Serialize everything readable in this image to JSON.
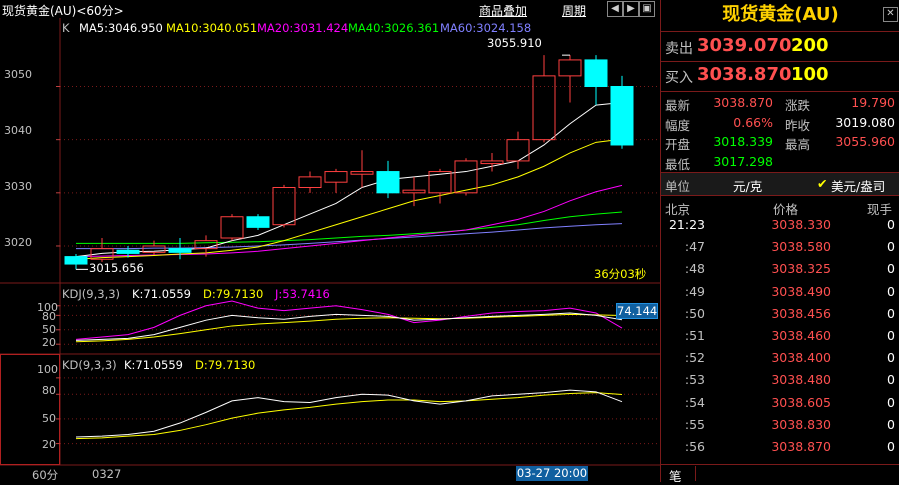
{
  "toolbar": {
    "title": "现货黄金(AU)<60分>",
    "overlay_link": "商品叠加",
    "period_link": "周期"
  },
  "main_chart": {
    "k_label": "K",
    "ma5": "MA5:3046.950",
    "ma10": "MA10:3040.051",
    "ma20": "MA20:3031.424",
    "ma40": "MA40:3026.361",
    "ma60": "MA60:3024.158",
    "high_marker": "3055.910",
    "low_marker": "3015.656",
    "countdown": "36分03秒",
    "y_ticks": [
      "3050",
      "3040",
      "3030",
      "3020"
    ],
    "y_values": [
      3050,
      3040,
      3030,
      3020
    ],
    "ylim": [
      3013.6,
      3059.5
    ],
    "colors": {
      "ma5": "#ffffff",
      "ma10": "#ffff00",
      "ma20": "#ff00ff",
      "ma40": "#00ff00",
      "ma60": "#8080ff",
      "up": "#ff4040",
      "down": "#00ffff"
    },
    "candles": [
      {
        "o": 3018.0,
        "h": 3018.5,
        "l": 3015.6,
        "c": 3016.6
      },
      {
        "o": 3017.5,
        "h": 3021.5,
        "l": 3017.0,
        "c": 3019.5
      },
      {
        "o": 3019.2,
        "h": 3020.0,
        "l": 3017.8,
        "c": 3018.6
      },
      {
        "o": 3018.8,
        "h": 3021.0,
        "l": 3018.3,
        "c": 3020.0
      },
      {
        "o": 3019.5,
        "h": 3021.5,
        "l": 3017.5,
        "c": 3018.8
      },
      {
        "o": 3019.5,
        "h": 3022.0,
        "l": 3018.0,
        "c": 3021.0
      },
      {
        "o": 3021.5,
        "h": 3026.0,
        "l": 3021.0,
        "c": 3025.5
      },
      {
        "o": 3025.5,
        "h": 3026.0,
        "l": 3023.0,
        "c": 3023.5
      },
      {
        "o": 3024.0,
        "h": 3031.5,
        "l": 3023.5,
        "c": 3031.0
      },
      {
        "o": 3031.0,
        "h": 3034.0,
        "l": 3030.0,
        "c": 3033.0
      },
      {
        "o": 3032.0,
        "h": 3034.5,
        "l": 3030.0,
        "c": 3034.0
      },
      {
        "o": 3033.5,
        "h": 3038.0,
        "l": 3031.0,
        "c": 3034.0
      },
      {
        "o": 3034.0,
        "h": 3036.0,
        "l": 3029.0,
        "c": 3030.0
      },
      {
        "o": 3030.0,
        "h": 3033.0,
        "l": 3027.5,
        "c": 3030.5
      },
      {
        "o": 3030.0,
        "h": 3034.5,
        "l": 3028.0,
        "c": 3034.0
      },
      {
        "o": 3030.0,
        "h": 3036.5,
        "l": 3029.5,
        "c": 3036.0
      },
      {
        "o": 3035.5,
        "h": 3037.5,
        "l": 3034.0,
        "c": 3036.0
      },
      {
        "o": 3036.0,
        "h": 3041.5,
        "l": 3034.5,
        "c": 3040.0
      },
      {
        "o": 3040.0,
        "h": 3055.9,
        "l": 3039.5,
        "c": 3052.0
      },
      {
        "o": 3052.0,
        "h": 3055.9,
        "l": 3047.0,
        "c": 3055.0
      },
      {
        "o": 3055.0,
        "h": 3055.9,
        "l": 3046.5,
        "c": 3050.0
      },
      {
        "o": 3050.0,
        "h": 3052.0,
        "l": 3038.3,
        "c": 3039.0
      }
    ],
    "ma5_vals": [
      3018.0,
      3018.6,
      3018.9,
      3019.0,
      3019.3,
      3019.6,
      3021.0,
      3022.0,
      3024.0,
      3026.0,
      3028.0,
      3031.0,
      3032.5,
      3033.0,
      3033.5,
      3034.0,
      3035.0,
      3036.0,
      3039.0,
      3043.0,
      3046.5,
      3047.0
    ],
    "ma10_vals": [
      3017.5,
      3017.8,
      3018.0,
      3018.2,
      3018.5,
      3018.7,
      3019.2,
      3019.8,
      3021.0,
      3022.5,
      3024.0,
      3025.5,
      3027.0,
      3028.5,
      3029.5,
      3030.5,
      3031.5,
      3033.0,
      3035.0,
      3037.5,
      3039.5,
      3040.1
    ],
    "ma20_vals": [
      3018.0,
      3018.1,
      3018.2,
      3018.3,
      3018.4,
      3018.5,
      3018.7,
      3019.0,
      3019.5,
      3020.0,
      3020.5,
      3021.0,
      3021.5,
      3022.0,
      3022.5,
      3023.0,
      3024.0,
      3025.0,
      3026.5,
      3028.5,
      3030.2,
      3031.4
    ],
    "ma40_vals": [
      3020.5,
      3020.5,
      3020.5,
      3020.5,
      3020.5,
      3020.6,
      3020.7,
      3020.8,
      3021.0,
      3021.2,
      3021.5,
      3021.8,
      3022.0,
      3022.3,
      3022.6,
      3023.0,
      3023.5,
      3024.0,
      3024.8,
      3025.5,
      3026.0,
      3026.4
    ],
    "ma60_vals": [
      3019.5,
      3019.5,
      3019.5,
      3019.6,
      3019.6,
      3019.7,
      3019.8,
      3020.0,
      3020.2,
      3020.5,
      3020.8,
      3021.1,
      3021.4,
      3021.7,
      3022.0,
      3022.3,
      3022.6,
      3023.0,
      3023.4,
      3023.7,
      3024.0,
      3024.2
    ]
  },
  "kdj_panel": {
    "label": "KDJ(9,3,3)",
    "k": "K:71.0559",
    "d": "D:79.7130",
    "j": "J:53.7416",
    "current_badge": "74.144",
    "y_ticks": [
      "100",
      "80",
      "50",
      "20"
    ],
    "y_values": [
      100,
      80,
      50,
      20
    ],
    "ylim": [
      10,
      112
    ],
    "k_vals": [
      28,
      30,
      32,
      40,
      55,
      70,
      80,
      75,
      72,
      78,
      82,
      80,
      78,
      70,
      72,
      75,
      78,
      80,
      82,
      85,
      80,
      71
    ],
    "d_vals": [
      25,
      27,
      30,
      35,
      42,
      50,
      58,
      62,
      65,
      68,
      72,
      74,
      75,
      74,
      73,
      74,
      76,
      78,
      80,
      82,
      81,
      79.7
    ],
    "j_vals": [
      30,
      35,
      40,
      55,
      80,
      100,
      110,
      95,
      90,
      95,
      100,
      92,
      82,
      65,
      70,
      78,
      85,
      88,
      90,
      95,
      85,
      53.7
    ]
  },
  "kd_panel": {
    "label": "KD(9,3,3)",
    "k": "K:71.0559",
    "d": "D:79.7130",
    "y_ticks": [
      "100",
      "80",
      "50",
      "20"
    ],
    "y_values": [
      100,
      80,
      50,
      20
    ],
    "ylim": [
      0,
      112
    ],
    "k_vals": [
      28,
      29,
      31,
      35,
      45,
      58,
      72,
      76,
      71,
      70,
      76,
      80,
      79,
      72,
      68,
      72,
      78,
      80,
      82,
      85,
      83,
      71
    ],
    "d_vals": [
      26,
      27,
      29,
      31,
      36,
      43,
      51,
      57,
      61,
      64,
      68,
      71,
      73,
      73,
      71,
      72,
      74,
      76,
      79,
      81,
      82,
      79.7
    ]
  },
  "bottom_axis": {
    "period": "60分",
    "date_start": "0327",
    "cursor_time": "03-27 20:00"
  },
  "quote_panel": {
    "title": "现货黄金(AU)",
    "sell_label": "卖出",
    "sell_price": "3039.070",
    "sell_vol": "200",
    "buy_label": "买入",
    "buy_price": "3038.870",
    "buy_vol": "100",
    "stats": [
      {
        "l1": "最新",
        "v1": "3038.870",
        "c1": "#ff5050",
        "l2": "涨跌",
        "v2": "19.790",
        "c2": "#ff5050"
      },
      {
        "l1": "幅度",
        "v1": "0.66%",
        "c1": "#ff5050",
        "l2": "昨收",
        "v2": "3019.080",
        "c2": "#ffffff"
      },
      {
        "l1": "开盘",
        "v1": "3018.339",
        "c1": "#00ff00",
        "l2": "最高",
        "v2": "3055.960",
        "c2": "#ff5050"
      },
      {
        "l1": "最低",
        "v1": "3017.298",
        "c1": "#00ff00",
        "l2": "",
        "v2": "",
        "c2": "#ffffff"
      }
    ],
    "unit_label": "单位",
    "unit_value": "元/克",
    "unit_option": "美元/盎司",
    "col_city": "北京",
    "col_price": "价格",
    "col_vol": "现手",
    "ticks": [
      {
        "time": "21:23",
        "price": "3038.330",
        "vol": "0"
      },
      {
        "time": ":47",
        "price": "3038.580",
        "vol": "0"
      },
      {
        "time": ":48",
        "price": "3038.325",
        "vol": "0"
      },
      {
        "time": ":49",
        "price": "3038.490",
        "vol": "0"
      },
      {
        "time": ":50",
        "price": "3038.456",
        "vol": "0"
      },
      {
        "time": ":51",
        "price": "3038.460",
        "vol": "0"
      },
      {
        "time": ":52",
        "price": "3038.400",
        "vol": "0"
      },
      {
        "time": ":53",
        "price": "3038.480",
        "vol": "0"
      },
      {
        "time": ":54",
        "price": "3038.605",
        "vol": "0"
      },
      {
        "time": ":55",
        "price": "3038.830",
        "vol": "0"
      },
      {
        "time": ":56",
        "price": "3038.870",
        "vol": "0"
      }
    ],
    "footer_tab": "笔"
  }
}
